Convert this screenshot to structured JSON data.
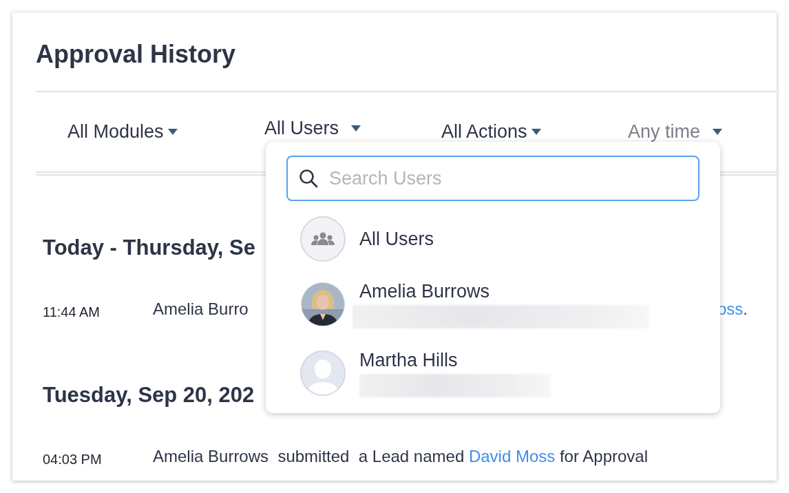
{
  "title": "Approval History",
  "filters": [
    {
      "label": "All Modules",
      "expanded": false,
      "dimmed": false
    },
    {
      "label": "All Users",
      "expanded": true,
      "dimmed": false
    },
    {
      "label": "All Actions",
      "expanded": false,
      "dimmed": false
    },
    {
      "label": "Any time",
      "expanded": false,
      "dimmed": true
    }
  ],
  "sections": [
    {
      "heading": "Today - Thursday, Se",
      "entries": [
        {
          "time": "11:44 AM",
          "parts": [
            {
              "kind": "text",
              "text": "Amelia Burro"
            }
          ],
          "tail": [
            {
              "kind": "link",
              "text": "oss"
            },
            {
              "kind": "text",
              "text": "."
            }
          ]
        }
      ]
    },
    {
      "heading": "Tuesday, Sep 20, 202",
      "entries": [
        {
          "time": "04:03 PM",
          "parts": [
            {
              "kind": "text",
              "text": "Amelia Burrows  submitted  a Lead named "
            },
            {
              "kind": "link",
              "text": "David Moss"
            },
            {
              "kind": "text",
              "text": " for Approval"
            }
          ]
        }
      ]
    }
  ],
  "user_menu": {
    "search": {
      "placeholder": "Search Users"
    },
    "users": [
      {
        "name": "All Users",
        "kind": "group",
        "detail_hidden": false
      },
      {
        "name": "Amelia Burrows",
        "kind": "picture",
        "detail_hidden": true
      },
      {
        "name": "Martha Hills",
        "kind": "silhouette",
        "detail_hidden": true
      }
    ]
  }
}
